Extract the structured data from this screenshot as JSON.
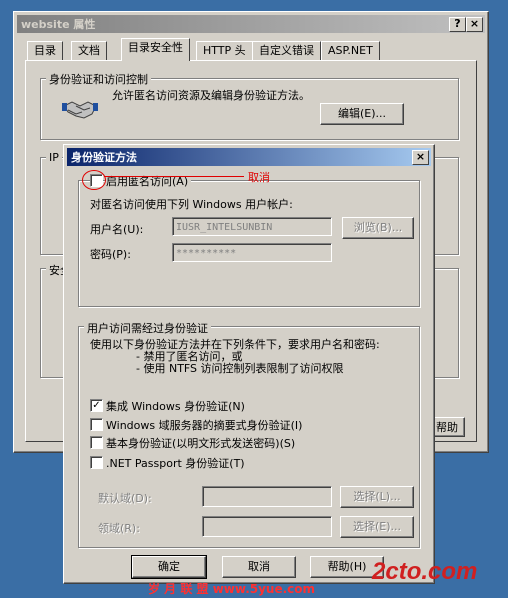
{
  "back_window": {
    "title": "website 属性",
    "help_btn": "?",
    "close_btn": "×",
    "tabs": [
      "目录",
      "文档",
      "目录安全性",
      "HTTP 头",
      "自定义错误",
      "ASP.NET"
    ],
    "auth_group_label": "身份验证和访问控制",
    "auth_desc": "允许匿名访问资源及编辑身份验证方法。",
    "edit_button": "编辑(E)...",
    "ip_group_label": "IP",
    "secure_group_label": "安全",
    "help_button_partial": "帮助"
  },
  "dialog": {
    "title": "身份验证方法",
    "close_btn": "×",
    "anon_checkbox": {
      "label": "启用匿名访问(A)",
      "checked": false
    },
    "annotation": "取消",
    "anon_desc": "对匿名访问使用下列 Windows 用户帐户:",
    "username_label": "用户名(U):",
    "username_value": "IUSR_INTELSUNBIN",
    "browse_button": "浏览(B)...",
    "password_label": "密码(P):",
    "password_value": "**********",
    "auth_group_label": "用户访问需经过身份验证",
    "auth_desc_1": "使用以下身份验证方法并在下列条件下，要求用户名和密码:",
    "auth_desc_2": "- 禁用了匿名访问，或",
    "auth_desc_3": "- 使用 NTFS 访问控制列表限制了访问权限",
    "methods": [
      {
        "label": "集成 Windows 身份验证(N)",
        "checked": true
      },
      {
        "label": "Windows 域服务器的摘要式身份验证(I)",
        "checked": false
      },
      {
        "label": "基本身份验证(以明文形式发送密码)(S)",
        "checked": false
      },
      {
        "label": ".NET Passport 身份验证(T)",
        "checked": false
      }
    ],
    "default_domain_label": "默认域(D):",
    "realm_label": "领域(R):",
    "select_button_1": "选择(L)...",
    "select_button_2": "选择(E)...",
    "ok_button": "确定",
    "cancel_button": "取消",
    "help_button": "帮助(H)"
  },
  "watermarks": {
    "left": "岁 月 联 盟   www.5yue.com",
    "right": "2cto.com"
  },
  "colors": {
    "desktop": "#3a6ea5",
    "annotation_red": "#e00000"
  }
}
